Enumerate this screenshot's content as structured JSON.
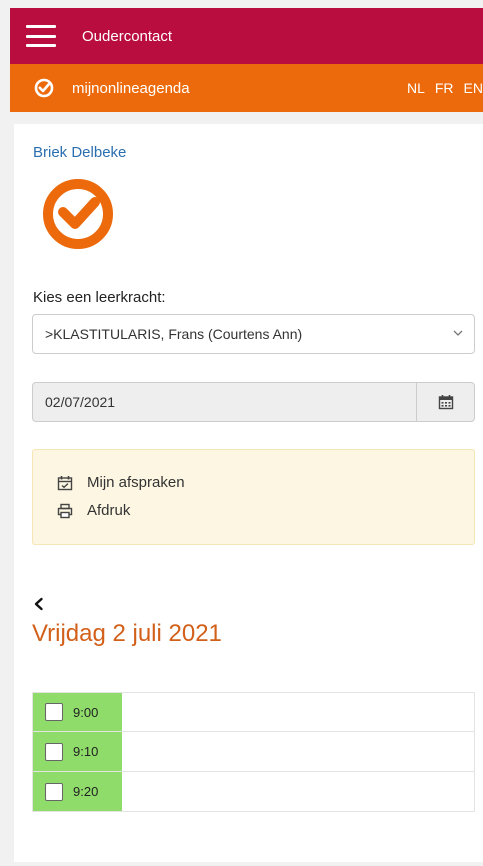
{
  "header": {
    "title": "Oudercontact"
  },
  "brand": {
    "name": "mijnonlineagenda"
  },
  "languages": [
    "NL",
    "FR",
    "EN"
  ],
  "user": {
    "name": "Briek Delbeke"
  },
  "teacher": {
    "label": "Kies een leerkracht:",
    "selected": ">KLASTITULARIS, Frans (Courtens Ann)"
  },
  "date": {
    "value": "02/07/2021"
  },
  "actions": {
    "appointments": "Mijn afspraken",
    "print": "Afdruk"
  },
  "day": {
    "title": "Vrijdag 2 juli 2021"
  },
  "slots": [
    "9:00",
    "9:10",
    "9:20"
  ],
  "colors": {
    "header": "#b80d3e",
    "brand": "#ec6a0c",
    "slot": "#8fdc6a",
    "day_title": "#d2601a"
  }
}
